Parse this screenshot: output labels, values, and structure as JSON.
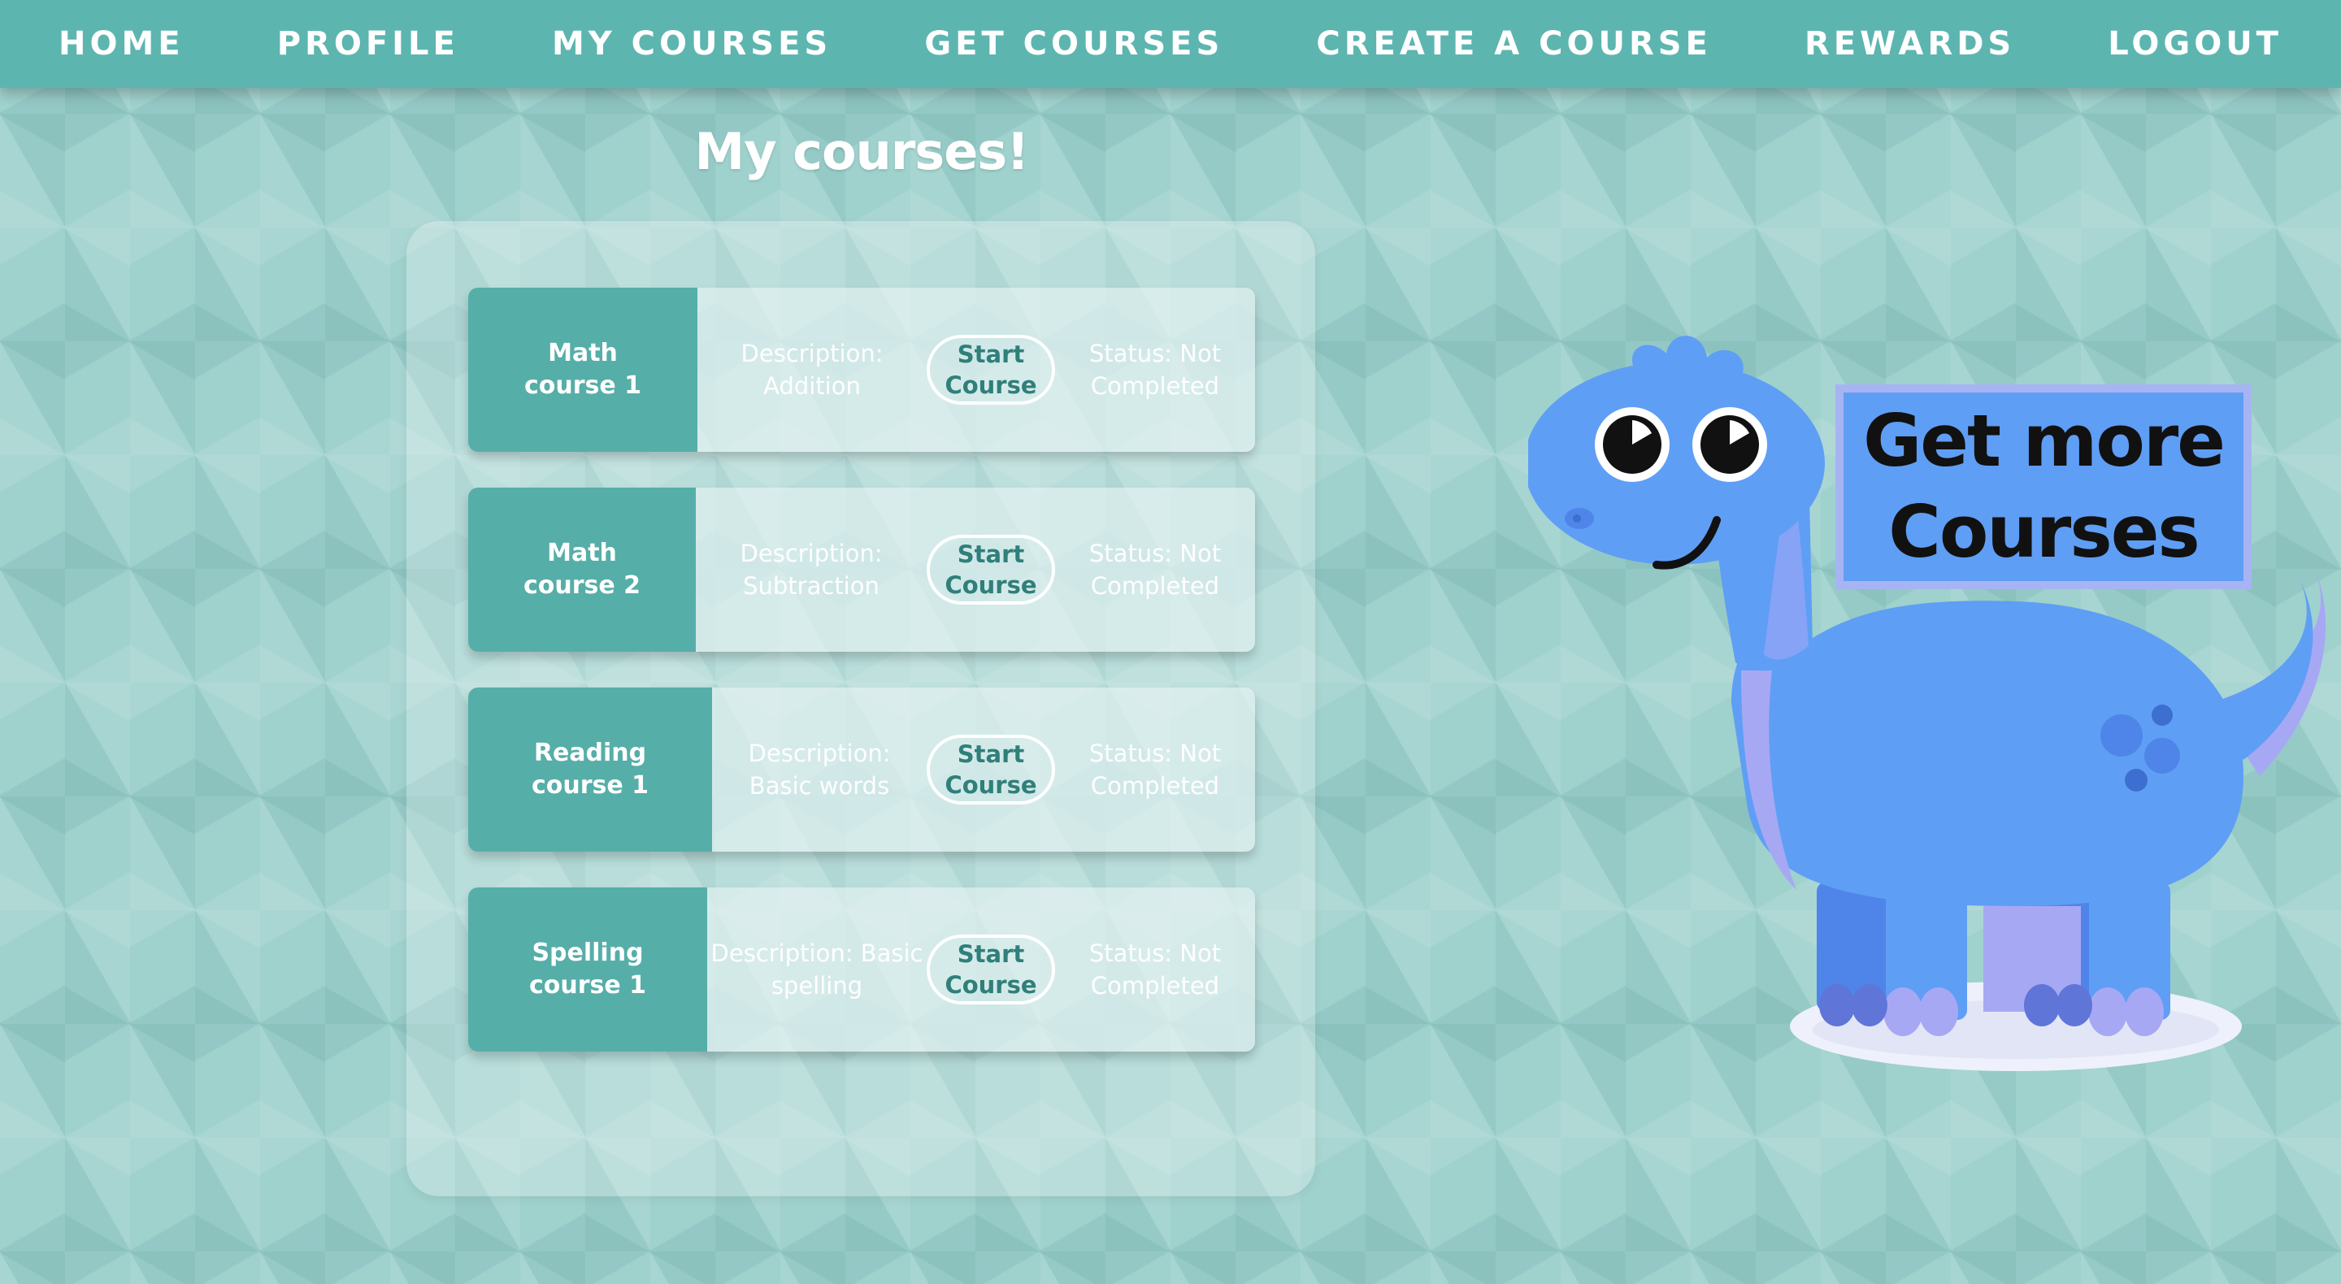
{
  "nav": {
    "items": [
      {
        "label": "HOME"
      },
      {
        "label": "PROFILE"
      },
      {
        "label": "MY COURSES"
      },
      {
        "label": "GET COURSES"
      },
      {
        "label": "CREATE A COURSE"
      },
      {
        "label": "REWARDS"
      },
      {
        "label": "LOGOUT"
      }
    ]
  },
  "page": {
    "title": "My courses!"
  },
  "courses": [
    {
      "name": "Math course 1",
      "description": "Description: Addition",
      "button_label": "Start Course",
      "status": "Status: Not Completed"
    },
    {
      "name": "Math course 2",
      "description": "Description: Subtraction",
      "button_label": "Start Course",
      "status": "Status: Not Completed"
    },
    {
      "name": "Reading course 1",
      "description": "Description: Basic words",
      "button_label": "Start Course",
      "status": "Status: Not Completed"
    },
    {
      "name": "Spelling course 1",
      "description": "Description: Basic spelling",
      "button_label": "Start Course",
      "status": "Status: Not Completed"
    }
  ],
  "promo": {
    "sign_text": "Get more Courses",
    "mascot_icon": "dinosaur-icon"
  },
  "colors": {
    "nav_background": "#5db5b0",
    "page_background": "#9fd1cd",
    "course_name_background": "#56aea8",
    "button_text": "#2f7f7a",
    "dino_body": "#5f9ef5",
    "dino_belly": "#a7a8f4",
    "sign_border": "#a7b4f4"
  }
}
